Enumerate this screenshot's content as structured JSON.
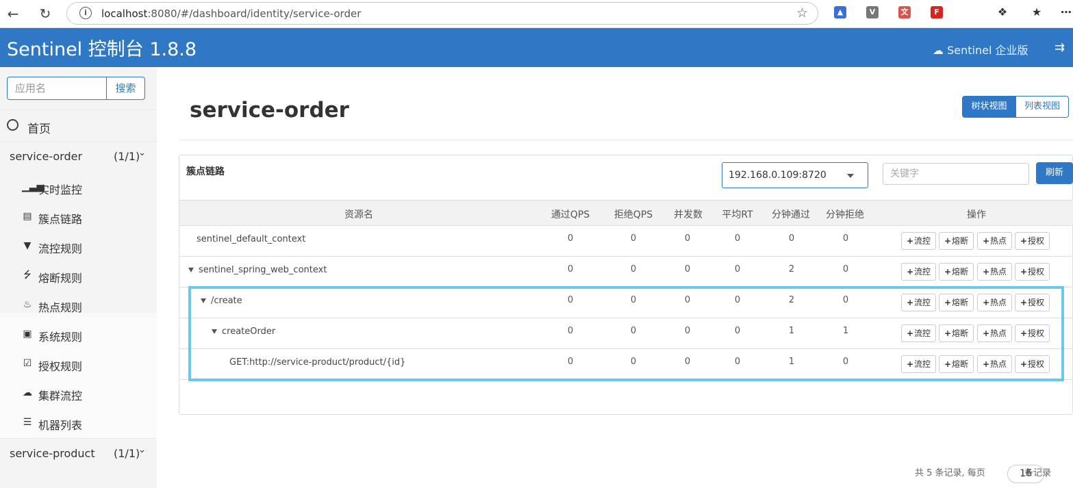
{
  "browser": {
    "url_host": "localhost",
    "url_rest": ":8080/#/dashboard/identity/service-order"
  },
  "header": {
    "brand": "Sentinel 控制台 1.8.8",
    "enterprise": "Sentinel 企业版"
  },
  "sidebar": {
    "search_placeholder": "应用名",
    "search_button": "搜索",
    "home": "首页",
    "apps": [
      {
        "name": "service-order",
        "count": "(1/1)"
      },
      {
        "name": "service-product",
        "count": "(1/1)"
      }
    ],
    "items": [
      {
        "label": "实时监控",
        "icon": "bar-chart-icon"
      },
      {
        "label": "簇点链路",
        "icon": "list-icon"
      },
      {
        "label": "流控规则",
        "icon": "filter-icon"
      },
      {
        "label": "熔断规则",
        "icon": "flash-icon"
      },
      {
        "label": "热点规则",
        "icon": "fire-icon"
      },
      {
        "label": "系统规则",
        "icon": "lock-icon"
      },
      {
        "label": "授权规则",
        "icon": "check-square-icon"
      },
      {
        "label": "集群流控",
        "icon": "cloud-icon"
      },
      {
        "label": "机器列表",
        "icon": "th-list-icon"
      }
    ]
  },
  "main": {
    "title": "service-order",
    "view_tree": "树状视图",
    "view_list": "列表视图",
    "panel_title": "簇点链路",
    "machine": "192.168.0.109:8720",
    "keyword_placeholder": "关键字",
    "refresh": "刷新",
    "columns": [
      "资源名",
      "通过QPS",
      "拒绝QPS",
      "并发数",
      "平均RT",
      "分钟通过",
      "分钟拒绝",
      "操作"
    ],
    "rows": [
      {
        "name": "sentinel_default_context",
        "values": [
          "0",
          "0",
          "0",
          "0",
          "0",
          "0"
        ]
      },
      {
        "name": "sentinel_spring_web_context",
        "values": [
          "0",
          "0",
          "0",
          "0",
          "2",
          "0"
        ]
      },
      {
        "name": "/create",
        "values": [
          "0",
          "0",
          "0",
          "0",
          "2",
          "0"
        ]
      },
      {
        "name": "createOrder",
        "values": [
          "0",
          "0",
          "0",
          "0",
          "1",
          "1"
        ]
      },
      {
        "name": "GET:http://service-product/product/{id}",
        "values": [
          "0",
          "0",
          "0",
          "0",
          "1",
          "0"
        ]
      }
    ],
    "actions": [
      "流控",
      "熔断",
      "热点",
      "授权"
    ],
    "pager_total": "共 5 条记录, 每页",
    "page_size": "16",
    "pager_unit": "条记录"
  }
}
